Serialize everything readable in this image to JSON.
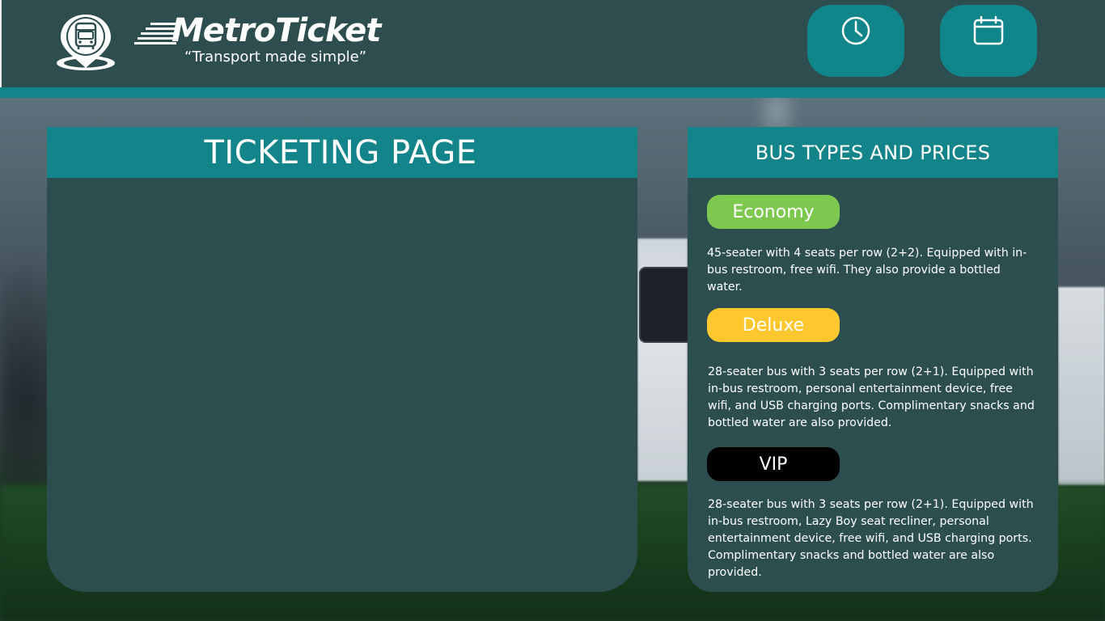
{
  "brand": {
    "name": "MetroTicket",
    "tagline": "“Transport made simple”",
    "logo_icon": "bus-location-pin-icon"
  },
  "header": {
    "buttons": [
      {
        "icon": "clock-icon"
      },
      {
        "icon": "calendar-icon"
      }
    ],
    "background": "#2d4d4e",
    "accent": "#13858a"
  },
  "ticketing": {
    "title": "TICKETING PAGE"
  },
  "bus_types": {
    "title": "BUS TYPES AND PRICES",
    "items": [
      {
        "label": "Economy",
        "color": "#7dc94f",
        "description": "45-seater with 4 seats per row (2+2). Equipped with in-bus restroom, free wifi. They also provide a bottled water."
      },
      {
        "label": "Deluxe",
        "color": "#ffc72e",
        "description": "28-seater bus with 3 seats per row (2+1). Equipped with in-bus restroom, personal entertainment device, free wifi, and USB charging ports. Complimentary snacks and bottled water are also provided."
      },
      {
        "label": "VIP",
        "color": "#000000",
        "description": "28-seater bus with 3 seats per row (2+1). Equipped with in-bus restroom, Lazy Boy seat recliner, personal entertainment device, free wifi, and USB charging ports. Complimentary snacks and bottled water are also provided."
      }
    ]
  }
}
